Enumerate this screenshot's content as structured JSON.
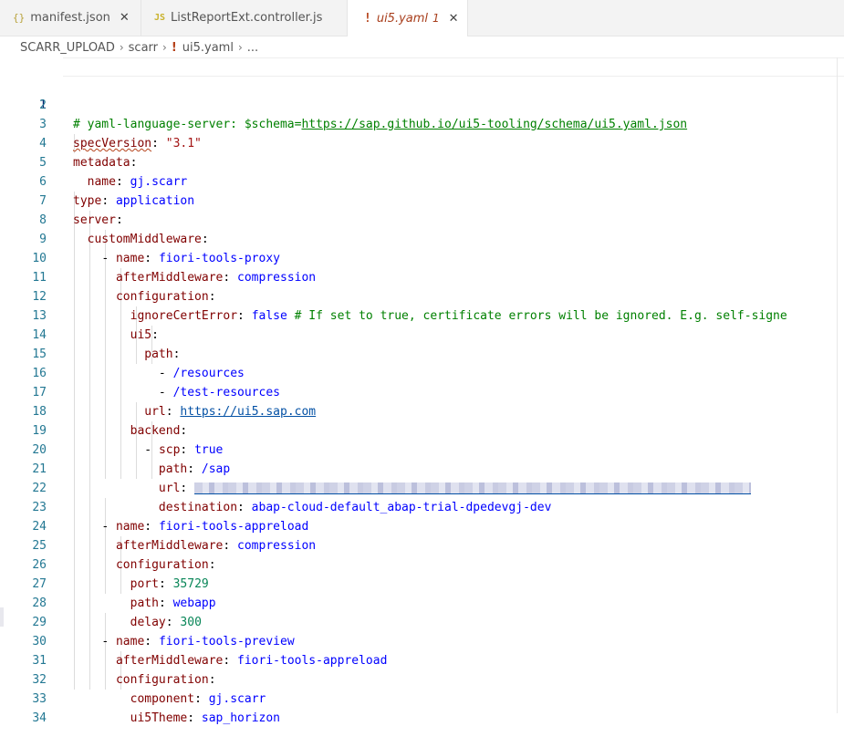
{
  "tabs": [
    {
      "icon": "{}",
      "label": "manifest.json",
      "close": "✕"
    },
    {
      "icon": "JS",
      "label": "ListReportExt.controller.js",
      "close": ""
    },
    {
      "icon": "!",
      "label": "ui5.yaml",
      "problems": "1",
      "close": "✕"
    }
  ],
  "breadcrumb": {
    "root": "SCARR_UPLOAD",
    "folder": "scarr",
    "file": "ui5.yaml",
    "more": "..."
  },
  "editor": {
    "line_numbers": [
      "1",
      "2",
      "3",
      "4",
      "5",
      "6",
      "7",
      "8",
      "9",
      "10",
      "11",
      "12",
      "13",
      "14",
      "15",
      "16",
      "17",
      "18",
      "19",
      "20",
      "21",
      "22",
      "23",
      "24",
      "25",
      "26",
      "27",
      "28",
      "29",
      "30",
      "31",
      "32",
      "33",
      "34"
    ],
    "schema_comment": "# yaml-language-server: $schema=",
    "schema_url": "https://sap.github.io/ui5-tooling/schema/ui5.yaml.json",
    "k_specVersion": "specVersion",
    "v_specVersion": "\"3.1\"",
    "k_metadata": "metadata",
    "k_name": "name",
    "v_app_name": "gj.scarr",
    "k_type": "type",
    "v_type": "application",
    "k_server": "server",
    "k_customMiddleware": "customMiddleware",
    "v_proxy": "fiori-tools-proxy",
    "k_afterMiddleware": "afterMiddleware",
    "v_compression": "compression",
    "k_configuration": "configuration",
    "k_ignoreCertError": "ignoreCertError",
    "v_false": "false",
    "c_ignore": "# If set to true, certificate errors will be ignored. E.g. self-signe",
    "k_ui5": "ui5",
    "k_path": "path",
    "v_resources": "/resources",
    "v_test_resources": "/test-resources",
    "k_url": "url",
    "v_ui5_url": "https://ui5.sap.com",
    "k_backend": "backend",
    "k_scp": "scp",
    "v_true": "true",
    "v_sap": "/sap",
    "k_destination": "destination",
    "v_destination": "abap-cloud-default_abap-trial-dpedevgj-dev",
    "v_appreload": "fiori-tools-appreload",
    "k_port": "port",
    "v_port": "35729",
    "v_webapp": "webapp",
    "k_delay": "delay",
    "v_delay": "300",
    "v_preview": "fiori-tools-preview",
    "k_component": "component",
    "v_component": "gj.scarr",
    "k_ui5Theme": "ui5Theme",
    "v_theme": "sap_horizon",
    "colon": ":",
    "dash": "- "
  }
}
